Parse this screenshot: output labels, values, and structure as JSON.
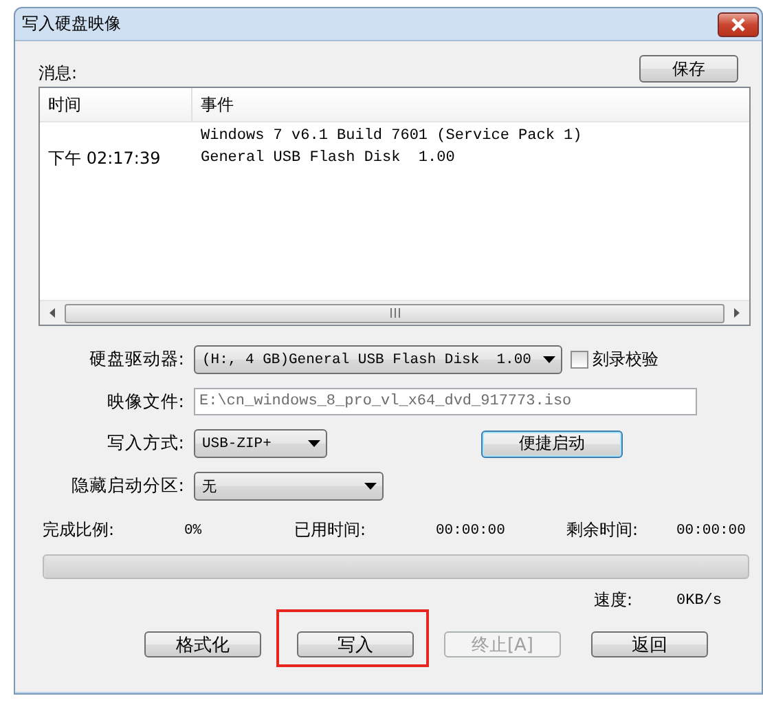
{
  "window": {
    "title": "写入硬盘映像"
  },
  "messages": {
    "label": "消息:",
    "save_button": "保存",
    "columns": [
      "时间",
      "事件"
    ],
    "rows": [
      {
        "event": "Windows 7 v6.1 Build 7601 (Service Pack 1)"
      },
      {
        "time": "下午 02:17:39",
        "event": "General USB Flash Disk  1.00"
      }
    ]
  },
  "form": {
    "drive": {
      "label": "硬盘驱动器:",
      "value": "(H:, 4 GB)General USB Flash Disk  1.00"
    },
    "verify": {
      "label": "刻录校验",
      "checked": false
    },
    "image_file": {
      "label": "映像文件:",
      "value": "E:\\cn_windows_8_pro_vl_x64_dvd_917773.iso"
    },
    "write_mode": {
      "label": "写入方式:",
      "value": "USB-ZIP+"
    },
    "quick_boot_button": "便捷启动",
    "hidden_partition": {
      "label": "隐藏启动分区:",
      "value": "无"
    }
  },
  "progress": {
    "stats": [
      {
        "label": "完成比例:",
        "value": "0%"
      },
      {
        "label": "已用时间:",
        "value": "00:00:00"
      },
      {
        "label": "剩余时间:",
        "value": "00:00:00"
      }
    ],
    "level": 0,
    "speed_label": "速度:",
    "speed": "0KB/s"
  },
  "buttons": [
    {
      "label": "格式化",
      "disabled": false,
      "highlighted": false
    },
    {
      "label": "写入",
      "disabled": false,
      "highlighted": true
    },
    {
      "label": "终止[A]",
      "disabled": true,
      "highlighted": false
    },
    {
      "label": "返回",
      "disabled": false,
      "highlighted": false
    }
  ]
}
